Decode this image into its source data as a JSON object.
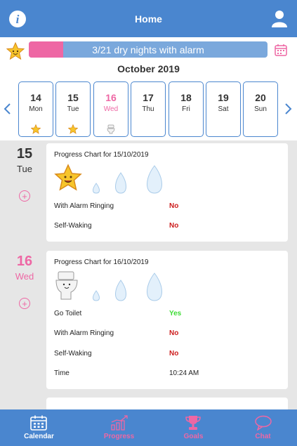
{
  "header": {
    "title": "Home",
    "info_icon": "info-icon",
    "profile_icon": "user-icon"
  },
  "progress": {
    "text": "3/21 dry nights with alarm",
    "fraction": 0.143,
    "fill_color": "#ee67a4",
    "bar_color": "#7aa8dc"
  },
  "calendar": {
    "month": "October 2019",
    "days": [
      {
        "num": "14",
        "weekday": "Mon",
        "mark": "star"
      },
      {
        "num": "15",
        "weekday": "Tue",
        "mark": "star"
      },
      {
        "num": "16",
        "weekday": "Wed",
        "mark": "toilet",
        "active": true
      },
      {
        "num": "17",
        "weekday": "Thu",
        "mark": ""
      },
      {
        "num": "18",
        "weekday": "Fri",
        "mark": ""
      },
      {
        "num": "19",
        "weekday": "Sat",
        "mark": ""
      },
      {
        "num": "20",
        "weekday": "Sun",
        "mark": ""
      }
    ]
  },
  "entries": [
    {
      "day_num": "15",
      "day_name": "Tue",
      "title": "Progress Chart for 15/10/2019",
      "rows": [
        {
          "label": "With Alarm Ringing",
          "value": "No"
        },
        {
          "label": "Self-Waking",
          "value": "No"
        }
      ]
    },
    {
      "day_num": "16",
      "day_name": "Wed",
      "title": "Progress Chart for 16/10/2019",
      "rows": [
        {
          "label": "Go Toilet",
          "value": "Yes"
        },
        {
          "label": "With Alarm Ringing",
          "value": "No"
        },
        {
          "label": "Self-Waking",
          "value": "No"
        },
        {
          "label": "Time",
          "value": "10:24 AM"
        }
      ]
    }
  ],
  "nav": [
    {
      "label": "Calendar",
      "icon": "calendar-icon"
    },
    {
      "label": "Progress",
      "icon": "chart-icon"
    },
    {
      "label": "Goals",
      "icon": "trophy-icon"
    },
    {
      "label": "Chat",
      "icon": "chat-icon"
    }
  ],
  "colors": {
    "primary": "#4a86cf",
    "accent": "#ee67a4",
    "no": "#cc1c1c",
    "yes": "#3ddc34"
  }
}
